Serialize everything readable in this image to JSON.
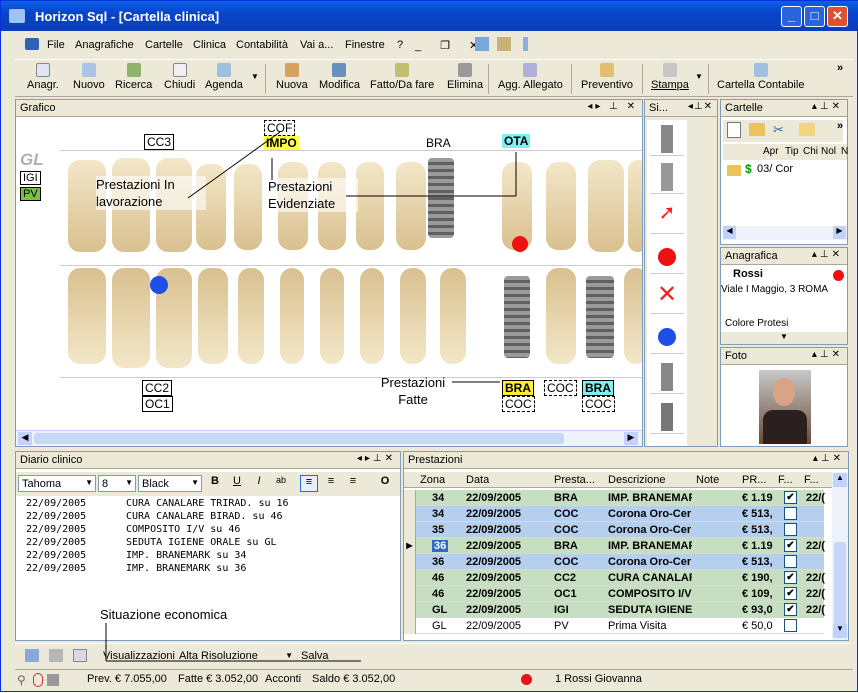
{
  "window": {
    "title": "Horizon Sql - [Cartella clinica]"
  },
  "menu": [
    "File",
    "Anagrafiche",
    "Cartelle",
    "Clinica",
    "Contabilità",
    "Vai a...",
    "Finestre",
    "?"
  ],
  "toolbar": [
    "Anagr.",
    "Nuovo",
    "Ricerca",
    "Chiudi",
    "Agenda",
    "Nuova",
    "Modifica",
    "Fatto/Da fare",
    "Elimina",
    "Agg. Allegato",
    "Preventivo",
    "Stampa",
    "Cartella Contabile"
  ],
  "grafico": {
    "title": "Grafico",
    "left_labels": {
      "gl": "GL",
      "igi": "IGI",
      "pv": "PV"
    },
    "top_labels": {
      "cc3": "CC3",
      "cof": "COF",
      "impo": "IMPO",
      "bra": "BRA",
      "ota": "OTA"
    },
    "bottom_labels": {
      "cc2": "CC2",
      "oc1": "OC1",
      "bra1": "BRA",
      "coc1": "COC",
      "coc2": "COC",
      "bra2": "BRA",
      "coc3": "COC"
    },
    "notes": {
      "in_lavorazione": "Prestazioni In lavorazione",
      "evidenziate": "Prestazioni Evidenziate",
      "fatte": "Prestazioni Fatte"
    }
  },
  "side_panel": {
    "title": "Si..."
  },
  "cartelle": {
    "title": "Cartelle",
    "columns": [
      "Apr",
      "Tip",
      "Chi",
      "Nol",
      "N"
    ],
    "row": "03/ Cor",
    "dollar": "$"
  },
  "anagrafica": {
    "title": "Anagrafica",
    "name": "Rossi",
    "address": "Viale I Maggio, 3 ROMA",
    "field": "Colore Protesi"
  },
  "foto": {
    "title": "Foto"
  },
  "diario": {
    "title": "Diario clinico",
    "font": "Tahoma",
    "size": "8",
    "color": "Black",
    "fmt": [
      "B",
      "U",
      "I",
      "ab",
      "O"
    ],
    "entries": [
      {
        "date": "22/09/2005",
        "text": "CURA CANALARE TRIRAD. su 16"
      },
      {
        "date": "22/09/2005",
        "text": "CURA CANALARE BIRAD. su 46"
      },
      {
        "date": "22/09/2005",
        "text": "COMPOSITO I/V su 46"
      },
      {
        "date": "22/09/2005",
        "text": "SEDUTA IGIENE ORALE su GL"
      },
      {
        "date": "22/09/2005",
        "text": "IMP. BRANEMARK su 34"
      },
      {
        "date": "22/09/2005",
        "text": "IMP. BRANEMARK su 36"
      }
    ],
    "note": "Situazione economica"
  },
  "prestazioni": {
    "title": "Prestazioni",
    "columns": [
      "Zona",
      "Data",
      "Presta...",
      "Descrizione",
      "Note",
      "PR...",
      "F...",
      "F..."
    ],
    "rows": [
      {
        "zona": "34",
        "data": "22/09/2005",
        "pre": "BRA",
        "desc": "IMP. BRANEMAF",
        "pr": "€ 1.19",
        "f1": "✔",
        "f2": "22/(",
        "color": "#c6dfc0"
      },
      {
        "zona": "34",
        "data": "22/09/2005",
        "pre": "COC",
        "desc": "Corona Oro-Cer",
        "pr": "€ 513,",
        "f1": "",
        "f2": "",
        "color": "#b5cfee"
      },
      {
        "zona": "35",
        "data": "22/09/2005",
        "pre": "COC",
        "desc": "Corona Oro-Cer",
        "pr": "€ 513,",
        "f1": "",
        "f2": "",
        "color": "#b5cfee"
      },
      {
        "zona": "36",
        "data": "22/09/2005",
        "pre": "BRA",
        "desc": "IMP. BRANEMAF",
        "pr": "€ 1.19",
        "f1": "✔",
        "f2": "22/(",
        "color": "#c6dfc0"
      },
      {
        "zona": "36",
        "data": "22/09/2005",
        "pre": "COC",
        "desc": "Corona Oro-Cer",
        "pr": "€ 513,",
        "f1": "",
        "f2": "",
        "color": "#b5cfee"
      },
      {
        "zona": "46",
        "data": "22/09/2005",
        "pre": "CC2",
        "desc": "CURA CANALAR",
        "pr": "€ 190,",
        "f1": "✔",
        "f2": "22/(",
        "color": "#c6dfc0"
      },
      {
        "zona": "46",
        "data": "22/09/2005",
        "pre": "OC1",
        "desc": "COMPOSITO I/V",
        "pr": "€ 109,",
        "f1": "✔",
        "f2": "22/(",
        "color": "#c6dfc0"
      },
      {
        "zona": "GL",
        "data": "22/09/2005",
        "pre": "IGI",
        "desc": "SEDUTA IGIENE",
        "pr": "€ 93,0",
        "f1": "✔",
        "f2": "22/(",
        "color": "#c6dfc0"
      },
      {
        "zona": "GL",
        "data": "22/09/2005",
        "pre": "PV",
        "desc": "Prima Visita",
        "pr": "€ 50,0",
        "f1": "",
        "f2": "",
        "color": "#ffffff"
      }
    ]
  },
  "bottom": {
    "visual_label": "Visualizzazioni",
    "visual_value": "Alta Risoluzione",
    "salva": "Salva"
  },
  "status": {
    "prev": "Prev. € 7.055,00",
    "fatte": "Fatte € 3.052,00",
    "acconti": "Acconti",
    "saldo": "Saldo € 3.052,00",
    "user": "1 Rossi Giovanna"
  }
}
